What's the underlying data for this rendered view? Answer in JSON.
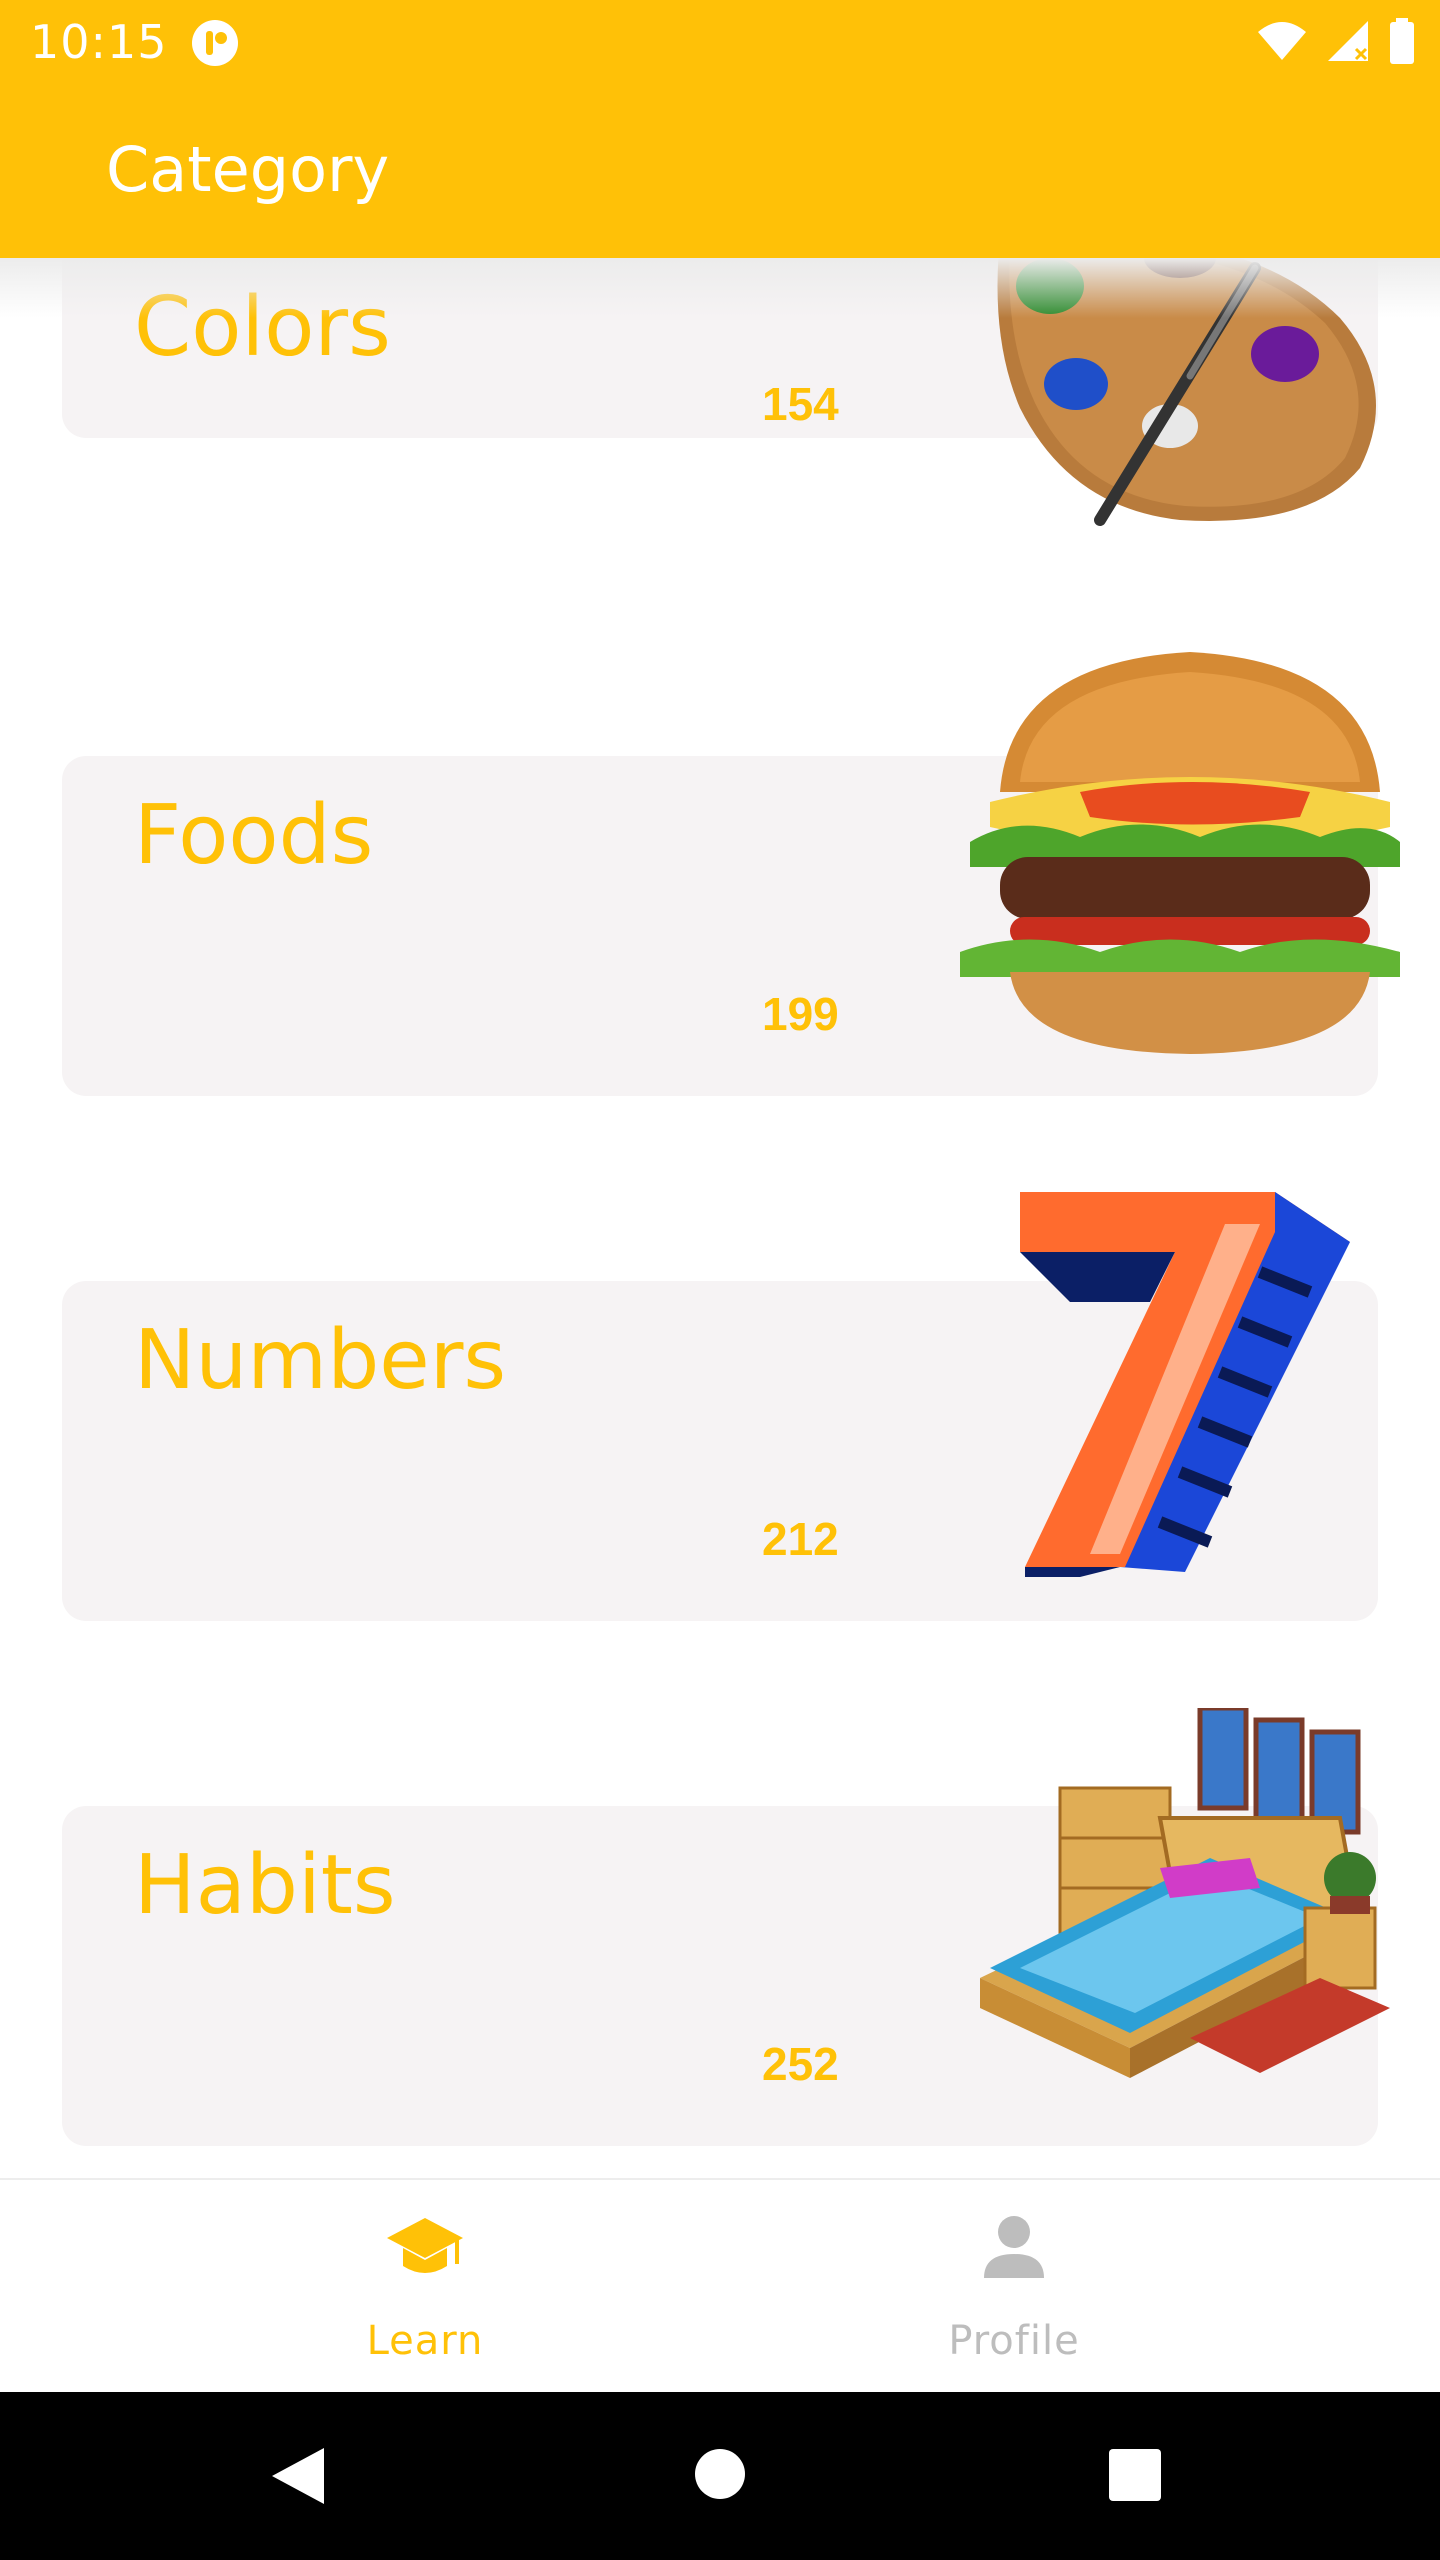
{
  "status_bar": {
    "time": "10:15",
    "icons": [
      "app-notification-icon",
      "wifi-icon",
      "signal-icon",
      "battery-icon"
    ]
  },
  "app_bar": {
    "title": "Category"
  },
  "categories": [
    {
      "title": "Colors",
      "count": "154",
      "image": "paint-palette-image"
    },
    {
      "title": "Foods",
      "count": "199",
      "image": "hamburger-image"
    },
    {
      "title": "Numbers",
      "count": "212",
      "image": "number-seven-image"
    },
    {
      "title": "Habits",
      "count": "252",
      "image": "bedroom-image"
    }
  ],
  "bottom_nav": {
    "items": [
      {
        "label": "Learn",
        "icon": "graduation-cap-icon",
        "active": true
      },
      {
        "label": "Profile",
        "icon": "person-icon",
        "active": false
      }
    ]
  },
  "colors": {
    "accent": "#FFC107",
    "card_bg": "#F6F3F4",
    "inactive": "#BDBDBD"
  },
  "system_nav": {
    "icons": [
      "back-icon",
      "home-icon",
      "recents-icon"
    ]
  }
}
